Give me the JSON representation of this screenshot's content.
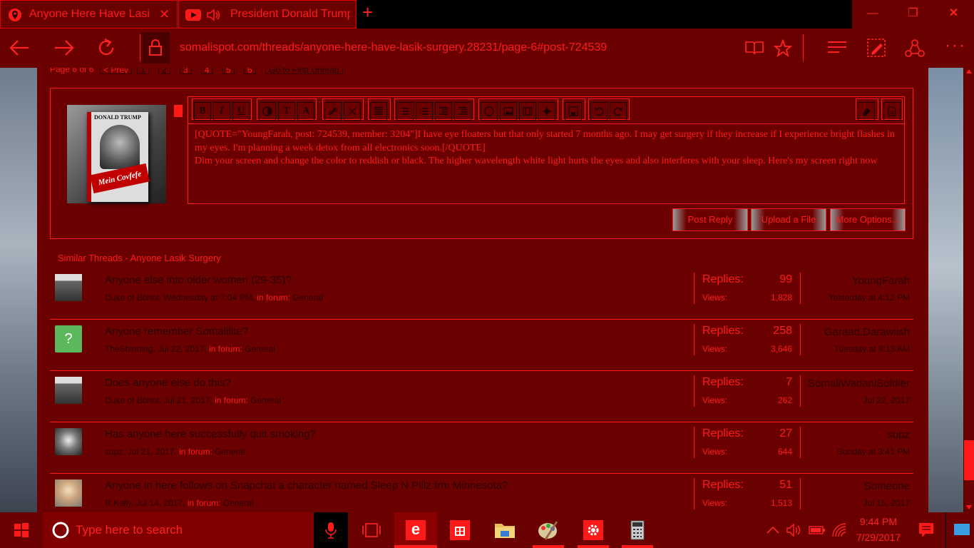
{
  "browser": {
    "tabs": [
      {
        "title": "Anyone Here Have Lasik",
        "close": "✕"
      },
      {
        "title": "President Donald Trump"
      }
    ],
    "new_tab": "+",
    "window_controls": {
      "minimize": "—",
      "restore": "❐",
      "close": "✕"
    },
    "url": "somalispot.com/threads/anyone-here-have-lasik-surgery.28231/page-6#post-724539"
  },
  "pagination": {
    "label": "Page 6 of 6",
    "prev": "< Prev",
    "pages": [
      "1",
      "2",
      "3",
      "4",
      "5",
      "6"
    ],
    "first_unread": "Go to First Unread"
  },
  "editor": {
    "text_line1": "[QUOTE=\"YoungFarah, post: 724539, member: 3204\"]I have eye floaters but that only started 7 months ago. I may get surgery if they increase if I experience bright flashes in my eyes. I'm planning a week detox from all electronics soon.[/QUOTE]",
    "text_line2": "Dim your screen and change the color to reddish or black. The higher wavelength white light hurts the eyes and also interferes with your sleep. Here's my screen right now",
    "buttons": {
      "post_reply": "Post Reply",
      "upload": "Upload a File",
      "more": "More Options..."
    },
    "avatar_text": {
      "top": "DONALD TRUMP",
      "bottom": "Mein Covfefe"
    },
    "toolbar": {
      "bold": "B",
      "italic": "I",
      "underline": "U",
      "text_color": "T",
      "font": "A"
    }
  },
  "similar": {
    "title": "Similar Threads - Anyone Lasik Surgery",
    "replies_label": "Replies:",
    "views_label": "Views:",
    "in_forum": "in forum:",
    "threads": [
      {
        "title": "Anyone else into older women (29-35)?",
        "author": "Duke of Bohol",
        "date": "Wednesday at 7:04 PM",
        "forum": "General",
        "replies": "99",
        "views": "1,828",
        "last_user": "YoungFarah",
        "last_date": "Yesterday at 4:12 PM",
        "thumb": "duke-avatar"
      },
      {
        "title": "Anyone remember Somalilite?",
        "author": "TheShinning",
        "date": "Jul 22, 2017",
        "forum": "General",
        "replies": "258",
        "views": "3,646",
        "last_user": "Garaad.Darawiish",
        "last_date": "Tuesday at 9:13 AM",
        "thumb": "question-avatar",
        "thumb_text": "?"
      },
      {
        "title": "Does anyone else do this?",
        "author": "Duke of Bohol",
        "date": "Jul 21, 2017",
        "forum": "General",
        "replies": "7",
        "views": "262",
        "last_user": "SomaliWadaniSoldier",
        "last_date": "Jul 22, 2017",
        "thumb": "duke-avatar"
      },
      {
        "title": "Has anyone here successfully quit smoking?",
        "author": "supz",
        "date": "Jul 21, 2017",
        "forum": "General",
        "replies": "27",
        "views": "644",
        "last_user": "supz",
        "last_date": "Sunday at 3:41 PM",
        "thumb": "supz-avatar"
      },
      {
        "title": "Anyone in here follows on Snapchat a character named Sleep N Pillz frm Minnesota?",
        "author": "R.Kelly",
        "date": "Jul 14, 2017",
        "forum": "General",
        "replies": "51",
        "views": "1,513",
        "last_user": "Someone",
        "last_date": "Jul 15, 2017",
        "thumb": "rkelly-avatar"
      }
    ]
  },
  "taskbar": {
    "search_placeholder": "Type here to search",
    "time": "9:44 PM",
    "date": "7/29/2017"
  },
  "colors": {
    "accent": "#ff1a1a",
    "background": "#6b0000",
    "dark_text": "#2a0000"
  }
}
